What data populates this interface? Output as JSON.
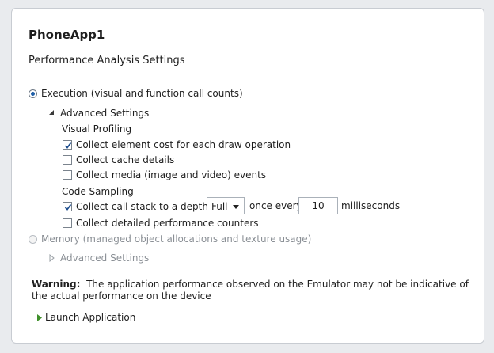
{
  "app_title": "PhoneApp1",
  "section_title": "Performance Analysis Settings",
  "execution": {
    "label": "Execution (visual and function call counts)",
    "selected": true,
    "advanced_label": "Advanced Settings",
    "visual_profiling": {
      "heading": "Visual Profiling",
      "options": [
        {
          "label": "Collect element cost for each draw operation",
          "checked": true
        },
        {
          "label": "Collect cache details",
          "checked": false
        },
        {
          "label": "Collect media (image and video) events",
          "checked": false
        }
      ]
    },
    "code_sampling": {
      "heading": "Code Sampling",
      "call_stack_label": "Collect call stack to a depth of",
      "call_stack_checked": true,
      "depth_value": "Full",
      "once_every_label": "once every",
      "interval_value": "10",
      "milliseconds_label": "milliseconds",
      "detailed_counters_label": "Collect detailed performance counters",
      "detailed_counters_checked": false
    }
  },
  "memory": {
    "label": "Memory (managed object allocations and texture usage)",
    "selected": false,
    "disabled": true,
    "advanced_label": "Advanced Settings"
  },
  "warning": {
    "prefix": "Warning:",
    "text": "The application performance observed on the Emulator may not be indicative of the actual performance on the device"
  },
  "launch_label": "Launch Application",
  "colors": {
    "accent": "#1f5fa8",
    "launch_arrow": "#3f8f2a",
    "disabled": "#8a8f95"
  },
  "icons": {
    "expanded": "triangle-down-icon",
    "collapsed": "triangle-right-icon",
    "launch": "play-icon"
  }
}
